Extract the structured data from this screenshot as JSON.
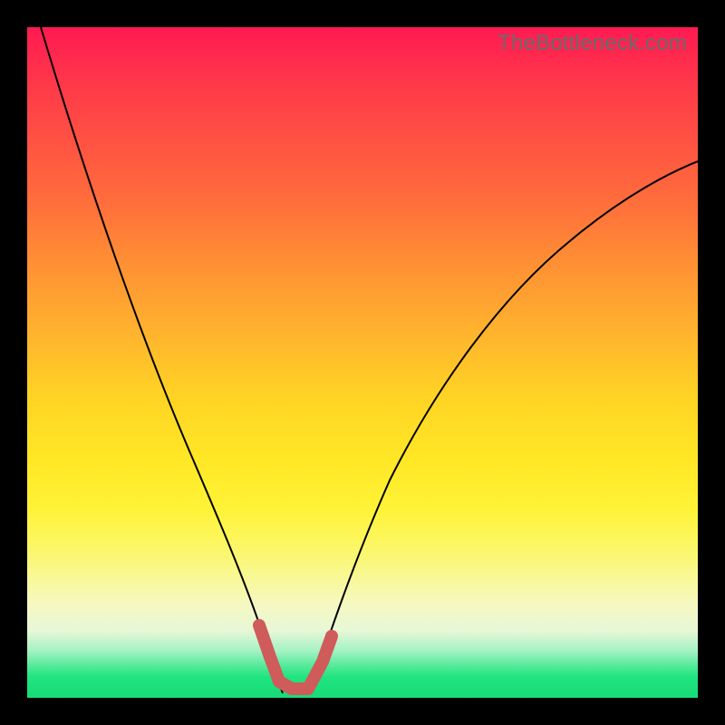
{
  "watermark": "TheBottleneck.com",
  "chart_data": {
    "type": "line",
    "title": "",
    "xlabel": "",
    "ylabel": "",
    "x_range": [
      0,
      1
    ],
    "y_range": [
      0,
      1
    ],
    "grid": false,
    "series": [
      {
        "name": "left-curve",
        "x": [
          0.02,
          0.06,
          0.1,
          0.14,
          0.18,
          0.22,
          0.26,
          0.29,
          0.32,
          0.34,
          0.355,
          0.37
        ],
        "y": [
          1.0,
          0.84,
          0.69,
          0.56,
          0.44,
          0.33,
          0.23,
          0.16,
          0.1,
          0.06,
          0.03,
          0.005
        ]
      },
      {
        "name": "right-curve",
        "x": [
          0.42,
          0.45,
          0.49,
          0.54,
          0.6,
          0.67,
          0.74,
          0.82,
          0.9,
          1.0
        ],
        "y": [
          0.005,
          0.06,
          0.15,
          0.27,
          0.4,
          0.52,
          0.61,
          0.69,
          0.75,
          0.8
        ]
      }
    ],
    "highlight_segments": [
      {
        "name": "left-marker",
        "x": [
          0.34,
          0.36,
          0.375,
          0.395,
          0.42
        ],
        "y": [
          0.1,
          0.04,
          0.01,
          0.008,
          0.008
        ]
      },
      {
        "name": "right-marker",
        "x": [
          0.42,
          0.44,
          0.455
        ],
        "y": [
          0.008,
          0.04,
          0.085
        ]
      }
    ],
    "background_gradient": {
      "top_color": "#ff1a52",
      "mid_color": "#ffe826",
      "bottom_color": "#17db78"
    }
  }
}
